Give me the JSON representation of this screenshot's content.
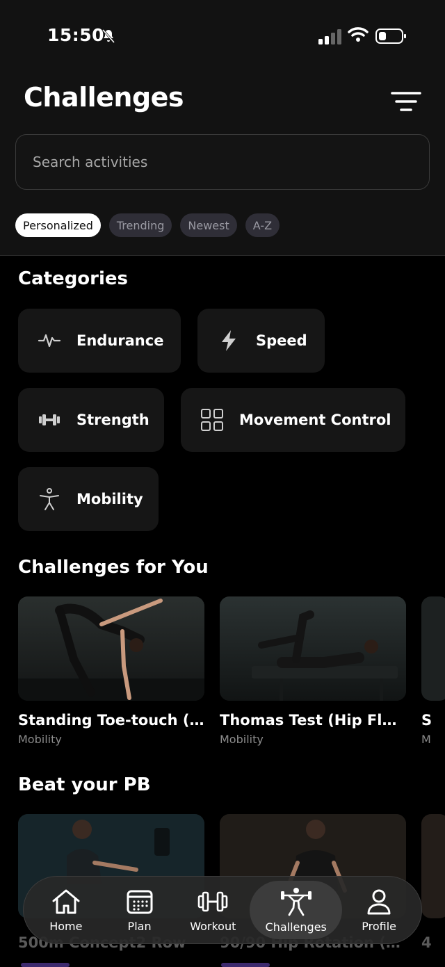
{
  "status_bar": {
    "time": "15:50",
    "icons": [
      "bell-off-icon",
      "signal-icon",
      "wifi-icon",
      "battery-icon"
    ]
  },
  "header": {
    "title": "Challenges",
    "filter_icon": "filter-icon"
  },
  "search": {
    "placeholder": "Search activities"
  },
  "sort_chips": [
    {
      "label": "Personalized",
      "active": true
    },
    {
      "label": "Trending",
      "active": false
    },
    {
      "label": "Newest",
      "active": false
    },
    {
      "label": "A-Z",
      "active": false
    }
  ],
  "categories": {
    "title": "Categories",
    "items": [
      {
        "label": "Endurance",
        "icon": "heartbeat-icon"
      },
      {
        "label": "Speed",
        "icon": "lightning-icon"
      },
      {
        "label": "Strength",
        "icon": "dumbbell-icon"
      },
      {
        "label": "Movement Control",
        "icon": "grid-icon"
      },
      {
        "label": "Mobility",
        "icon": "person-icon"
      }
    ]
  },
  "challenges_for_you": {
    "title": "Challenges for You",
    "cards": [
      {
        "title": "Standing Toe-touch (...",
        "category": "Mobility"
      },
      {
        "title": "Thomas Test (Hip Flex...",
        "category": "Mobility"
      }
    ],
    "peek": {
      "title": "S",
      "category": "M"
    }
  },
  "beat_your_pb": {
    "title": "Beat your PB",
    "cards": [
      {
        "title": "500m Concept2 Row"
      },
      {
        "title": "90/90 Hip Rotation (3..."
      }
    ],
    "peek": {
      "title": "4"
    }
  },
  "bottom_nav": [
    {
      "label": "Home",
      "icon": "home-icon",
      "active": false
    },
    {
      "label": "Plan",
      "icon": "calendar-icon",
      "active": false
    },
    {
      "label": "Workout",
      "icon": "dumbbell-icon",
      "active": false
    },
    {
      "label": "Challenges",
      "icon": "weightlifter-icon",
      "active": true
    },
    {
      "label": "Profile",
      "icon": "user-icon",
      "active": false
    }
  ],
  "colors": {
    "background": "#000000",
    "header": "#121212",
    "chip_inactive": "#2f2e37",
    "card": "#161616",
    "accent_purple": "#3d2a6e"
  }
}
